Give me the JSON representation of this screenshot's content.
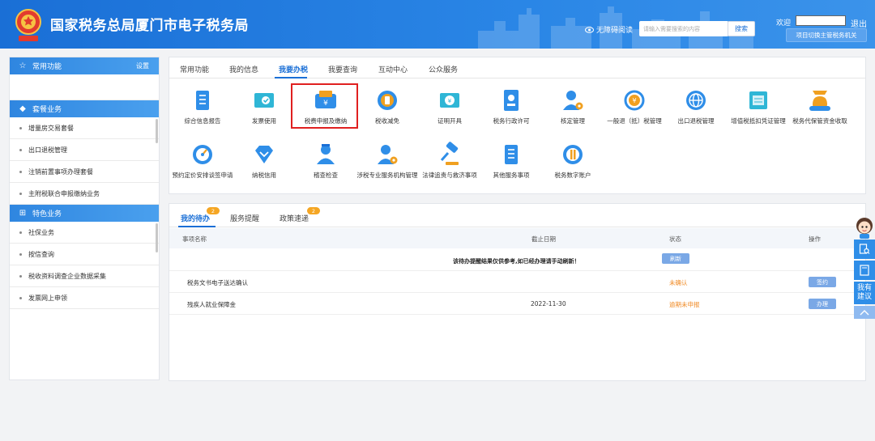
{
  "header": {
    "title": "国家税务总局厦门市电子税务局",
    "emblem_text": "中国税务",
    "accessibility": "无障碍阅读",
    "search_placeholder": "请输入需要搜索的内容",
    "search_button": "搜索",
    "welcome": "欢迎",
    "logout": "退出",
    "switch_agency": "项目切换主管税务机关"
  },
  "sidebar": {
    "common": {
      "title": "常用功能",
      "setting": "设置"
    },
    "package": {
      "title": "套餐业务",
      "items": [
        "增量房交易套餐",
        "出口退税管理",
        "注销前置事项办理套餐",
        "主附税联合申报缴纳业务"
      ]
    },
    "special": {
      "title": "特色业务",
      "items": [
        "社保业务",
        "按信查询",
        "税收资料调查企业数据采集",
        "发票网上申领"
      ]
    }
  },
  "main_tabs": [
    "常用功能",
    "我的信息",
    "我要办税",
    "我要查询",
    "互动中心",
    "公众服务"
  ],
  "tiles": [
    {
      "label": "综合信息报告",
      "icon": "report-icon",
      "color": "#2f8ee8"
    },
    {
      "label": "发票使用",
      "icon": "invoice-icon",
      "color": "#2fb6d6"
    },
    {
      "label": "税费申报及缴纳",
      "icon": "wallet-icon",
      "color": "#2f8ee8"
    },
    {
      "label": "税收减免",
      "icon": "coin-icon",
      "color": "#f0a020"
    },
    {
      "label": "证明开具",
      "icon": "certificate-icon",
      "color": "#2fb6d6"
    },
    {
      "label": "税务行政许可",
      "icon": "license-icon",
      "color": "#2f8ee8"
    },
    {
      "label": "核定管理",
      "icon": "person-gear-icon",
      "color": "#2f8ee8"
    },
    {
      "label": "一般退（抵）税管理",
      "icon": "refund-icon",
      "color": "#f0a020"
    },
    {
      "label": "出口退税管理",
      "icon": "globe-icon",
      "color": "#2f8ee8"
    },
    {
      "label": "增值税抵扣凭证管理",
      "icon": "ticket-icon",
      "color": "#2fb6d6"
    },
    {
      "label": "税务代保管资金收取",
      "icon": "money-bag-icon",
      "color": "#2f8ee8"
    },
    {
      "label": "预约定价安排谈签申请",
      "icon": "gauge-icon",
      "color": "#2f8ee8"
    },
    {
      "label": "纳税信用",
      "icon": "diamond-icon",
      "color": "#2f8ee8"
    },
    {
      "label": "稽查检查",
      "icon": "inspector-icon",
      "color": "#2f8ee8"
    },
    {
      "label": "涉税专业服务机构管理",
      "icon": "agent-gear-icon",
      "color": "#2f8ee8"
    },
    {
      "label": "法律追责与救济事项",
      "icon": "gavel-icon",
      "color": "#2f8ee8"
    },
    {
      "label": "其他服务事项",
      "icon": "list-icon",
      "color": "#2f8ee8"
    },
    {
      "label": "税务数字账户",
      "icon": "digital-coin-icon",
      "color": "#2f8ee8"
    }
  ],
  "todo": {
    "tabs": [
      {
        "label": "我的待办",
        "badge": "2"
      },
      {
        "label": "服务提醒",
        "badge": ""
      },
      {
        "label": "政策速递",
        "badge": "2"
      }
    ],
    "headers": {
      "name": "事项名称",
      "deadline": "截止日期",
      "status": "状态",
      "action": "操作"
    },
    "notice": "该待办提醒结果仅供参考,如已经办理请手动刷新！",
    "refresh": "刷新",
    "rows": [
      {
        "name": "税务文书电子送达确认",
        "deadline": "",
        "status": "未确认",
        "action": "签约"
      },
      {
        "name": "残疾人就业保障金",
        "deadline": "2022-11-30",
        "status": "逾期未申报",
        "action": "办理"
      }
    ]
  },
  "float": {
    "suggest": "我有建议"
  }
}
